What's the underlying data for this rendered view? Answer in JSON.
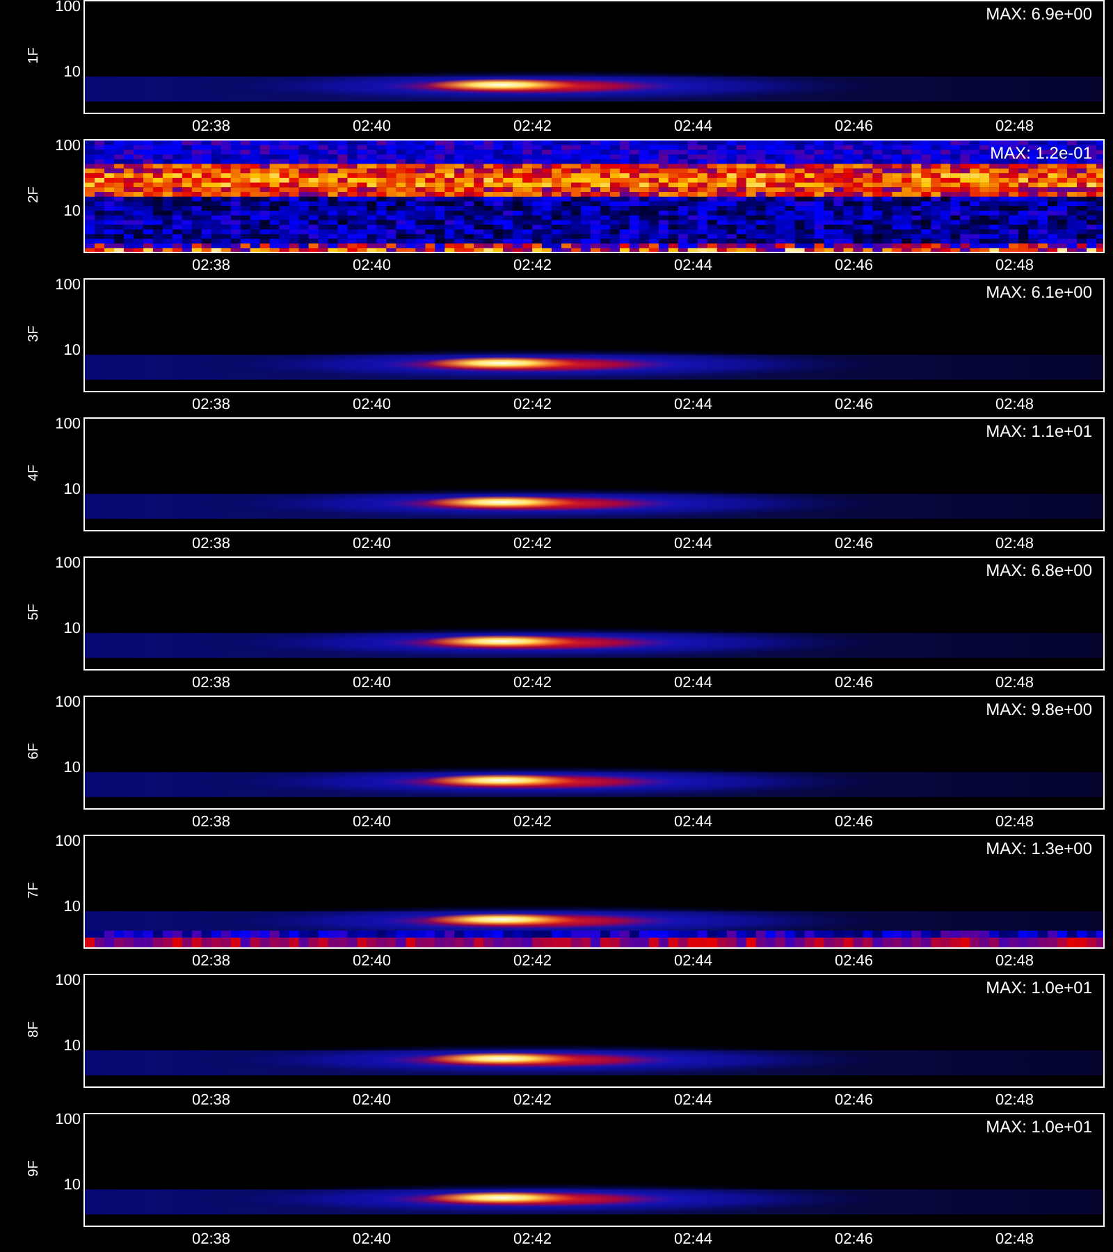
{
  "panels": [
    {
      "label": "1F",
      "y_ticks": [
        "100",
        "10"
      ],
      "max": "MAX: 6.9e+00",
      "kind": "burst",
      "x_ticks": [
        "02:38",
        "02:40",
        "02:42",
        "02:44",
        "02:46",
        "02:48"
      ]
    },
    {
      "label": "2F",
      "y_ticks": [
        "100",
        "10"
      ],
      "max": "MAX: 1.2e-01",
      "kind": "noise",
      "x_ticks": [
        "02:38",
        "02:40",
        "02:42",
        "02:44",
        "02:46",
        "02:48"
      ]
    },
    {
      "label": "3F",
      "y_ticks": [
        "100",
        "10"
      ],
      "max": "MAX: 6.1e+00",
      "kind": "burst",
      "x_ticks": [
        "02:38",
        "02:40",
        "02:42",
        "02:44",
        "02:46",
        "02:48"
      ]
    },
    {
      "label": "4F",
      "y_ticks": [
        "100",
        "10"
      ],
      "max": "MAX: 1.1e+01",
      "kind": "burst",
      "x_ticks": [
        "02:38",
        "02:40",
        "02:42",
        "02:44",
        "02:46",
        "02:48"
      ]
    },
    {
      "label": "5F",
      "y_ticks": [
        "100",
        "10"
      ],
      "max": "MAX: 6.8e+00",
      "kind": "burst",
      "x_ticks": [
        "02:38",
        "02:40",
        "02:42",
        "02:44",
        "02:46",
        "02:48"
      ]
    },
    {
      "label": "6F",
      "y_ticks": [
        "100",
        "10"
      ],
      "max": "MAX: 9.8e+00",
      "kind": "burst",
      "x_ticks": [
        "02:38",
        "02:40",
        "02:42",
        "02:44",
        "02:46",
        "02:48"
      ]
    },
    {
      "label": "7F",
      "y_ticks": [
        "100",
        "10"
      ],
      "max": "MAX: 1.3e+00",
      "kind": "banded",
      "x_ticks": [
        "02:38",
        "02:40",
        "02:42",
        "02:44",
        "02:46",
        "02:48"
      ]
    },
    {
      "label": "8F",
      "y_ticks": [
        "100",
        "10"
      ],
      "max": "MAX: 1.0e+01",
      "kind": "burst",
      "x_ticks": [
        "02:38",
        "02:40",
        "02:42",
        "02:44",
        "02:46",
        "02:48"
      ]
    },
    {
      "label": "9F",
      "y_ticks": [
        "100",
        "10"
      ],
      "max": "MAX: 1.0e+01",
      "kind": "burst",
      "x_ticks": [
        "02:38",
        "02:40",
        "02:42",
        "02:44",
        "02:46",
        "02:48"
      ]
    }
  ]
}
